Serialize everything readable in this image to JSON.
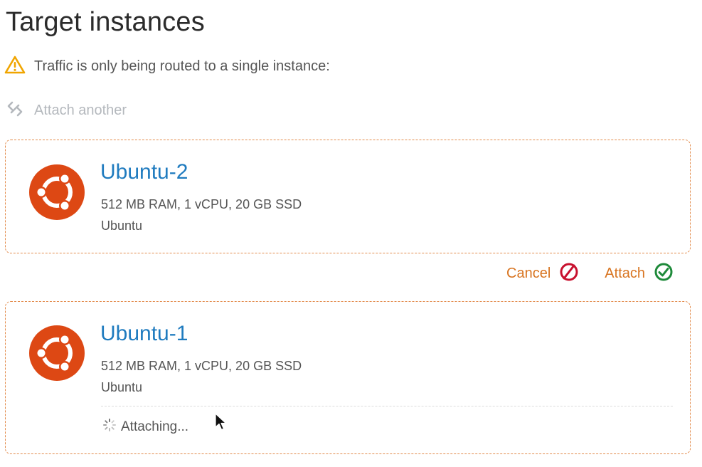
{
  "header": {
    "title": "Target instances"
  },
  "warning": {
    "icon": "warning-triangle-icon",
    "text": "Traffic is only being routed to a single instance:"
  },
  "attach_another": {
    "icon": "attach-link-icon",
    "label": "Attach another"
  },
  "instances": [
    {
      "name": "Ubuntu-2",
      "specs": "512 MB RAM, 1 vCPU, 20 GB SSD",
      "os": "Ubuntu",
      "icon": "ubuntu-logo-icon"
    },
    {
      "name": "Ubuntu-1",
      "specs": "512 MB RAM, 1 vCPU, 20 GB SSD",
      "os": "Ubuntu",
      "icon": "ubuntu-logo-icon",
      "status": "Attaching..."
    }
  ],
  "actions": {
    "cancel_label": "Cancel",
    "attach_label": "Attach"
  },
  "colors": {
    "accent_orange": "#d87420",
    "card_border": "#e28a4a",
    "link_blue": "#1f7bbf",
    "ubuntu_orange": "#dd4814",
    "cancel_red": "#c8102e",
    "attach_green": "#1e8a3a",
    "warning_yellow": "#f0a500"
  }
}
